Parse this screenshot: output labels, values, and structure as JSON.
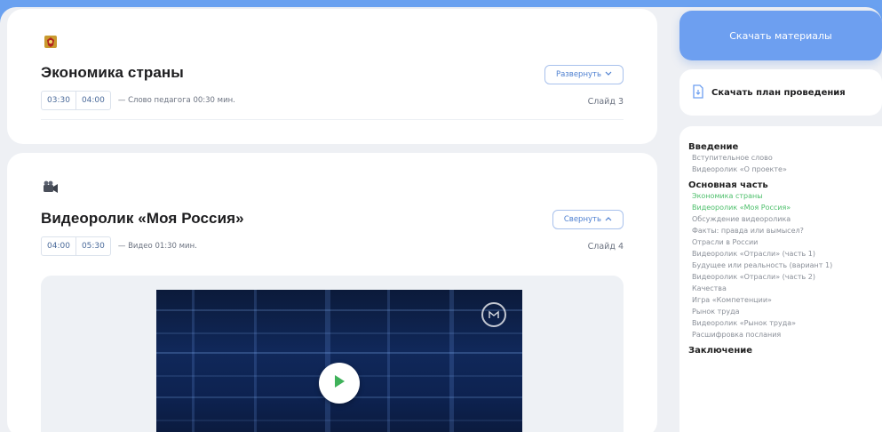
{
  "cards": [
    {
      "title": "Экономика страны",
      "time_start": "03:30",
      "time_end": "04:00",
      "note": "— Слово педагога 00:30 мин.",
      "toggle_label": "Развернуть",
      "toggle_icon": "chevron-down-icon",
      "slide": "Слайд 3",
      "icon": "coat-of-arms-icon"
    },
    {
      "title": "Видеоролик «Моя Россия»",
      "time_start": "04:00",
      "time_end": "05:30",
      "note": "— Видео 01:30 мин.",
      "toggle_label": "Свернуть",
      "toggle_icon": "chevron-up-icon",
      "slide": "Слайд 4",
      "icon": "video-camera-icon"
    }
  ],
  "sidebar": {
    "download_label": "Скачать материалы",
    "plan_label": "Скачать план проведения",
    "toc": [
      {
        "section": "Введение",
        "items": [
          {
            "label": "Вступительное слово",
            "active": false
          },
          {
            "label": "Видеоролик «О проекте»",
            "active": false
          }
        ]
      },
      {
        "section": "Основная часть",
        "items": [
          {
            "label": "Экономика страны",
            "active": true
          },
          {
            "label": "Видеоролик «Моя Россия»",
            "active": true
          },
          {
            "label": "Обсуждение видеоролика",
            "active": false
          },
          {
            "label": "Факты: правда или вымысел?",
            "active": false
          },
          {
            "label": "Отрасли в России",
            "active": false
          },
          {
            "label": "Видеоролик «Отрасли» (часть 1)",
            "active": false
          },
          {
            "label": "Будущее или реальность (вариант 1)",
            "active": false
          },
          {
            "label": "Видеоролик «Отрасли» (часть 2)",
            "active": false
          },
          {
            "label": "Качества",
            "active": false
          },
          {
            "label": "Игра «Компетенции»",
            "active": false
          },
          {
            "label": "Рынок труда",
            "active": false
          },
          {
            "label": "Видеоролик «Рынок труда»",
            "active": false
          },
          {
            "label": "Расшифровка послания",
            "active": false
          }
        ]
      },
      {
        "section": "Заключение",
        "items": []
      }
    ]
  },
  "colors": {
    "accent": "#6d9ff0",
    "active_item": "#4cbf6a",
    "play_icon": "#3fb25a"
  }
}
